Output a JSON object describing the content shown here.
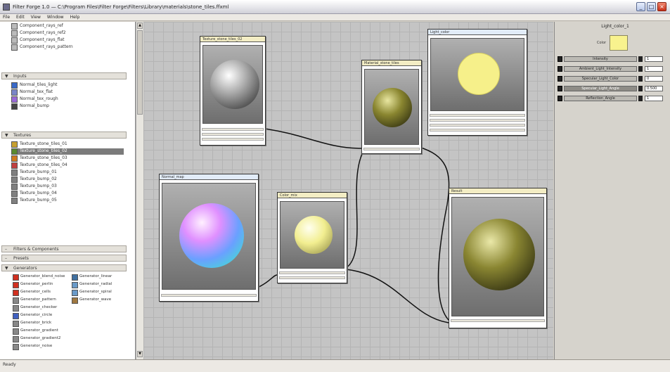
{
  "window": {
    "title": "Filter Forge 1.0 — C:\\Program Files\\Filter Forge\\Filters\\Library\\materials\\stone_tiles.ffxml",
    "minimize": "_",
    "restore": "□",
    "close": "×"
  },
  "menu": [
    "File",
    "Edit",
    "View",
    "Window",
    "Help"
  ],
  "left_panel": {
    "top_items": [
      {
        "label": "Component_rays_ref",
        "icon": "gray"
      },
      {
        "label": "Component_rays_ref2",
        "icon": "gray"
      },
      {
        "label": "Component_rays_flat",
        "icon": "gray"
      },
      {
        "label": "Component_rays_pattern",
        "icon": "gray"
      }
    ],
    "sections": {
      "inputs": "Inputs",
      "textures": "Textures",
      "filters_header": "Filters & Components",
      "presets": "Presets",
      "generators": "Generators"
    },
    "inputs_items": [
      {
        "label": "Normal_tiles_light",
        "color": "#3a6ac8"
      },
      {
        "label": "Normal_tex_flat",
        "color": "#7a86c8"
      },
      {
        "label": "Normal_tex_rough",
        "color": "#9a6ad8"
      },
      {
        "label": "Normal_bump",
        "color": "#444444"
      }
    ],
    "textures_items": [
      {
        "label": "Texture_stone_tiles_01",
        "color": "#c8a030",
        "selected": false
      },
      {
        "label": "Texture_stone_tiles_02",
        "color": "#5a8a30",
        "selected": true
      },
      {
        "label": "Texture_stone_tiles_03",
        "color": "#d07a20",
        "selected": false
      },
      {
        "label": "Texture_stone_tiles_04",
        "color": "#c04040",
        "selected": false
      },
      {
        "label": "Texture_bump_01",
        "color": "#808080",
        "selected": false
      },
      {
        "label": "Texture_bump_02",
        "color": "#808080",
        "selected": false
      },
      {
        "label": "Texture_bump_03",
        "color": "#808080",
        "selected": false
      },
      {
        "label": "Texture_bump_04",
        "color": "#808080",
        "selected": false
      },
      {
        "label": "Texture_bump_05",
        "color": "#808080",
        "selected": false
      }
    ],
    "generators_left": [
      {
        "label": "Generator_blend_noise",
        "color": "#d03020"
      },
      {
        "label": "Generator_perlin",
        "color": "#d03020"
      },
      {
        "label": "Generator_cells",
        "color": "#d03020"
      },
      {
        "label": "Generator_pattern",
        "color": "#888888"
      },
      {
        "label": "Generator_checker",
        "color": "#888888"
      },
      {
        "label": "Generator_circle",
        "color": "#4060c0"
      },
      {
        "label": "Generator_brick",
        "color": "#888888"
      },
      {
        "label": "Generator_gradient",
        "color": "#888888"
      },
      {
        "label": "Generator_gradient2",
        "color": "#888888"
      },
      {
        "label": "Generator_noise",
        "color": "#888888"
      }
    ],
    "generators_right": [
      {
        "label": "Generator_linear",
        "color": "#4070a0"
      },
      {
        "label": "Generator_radial",
        "color": "#6a9ac8"
      },
      {
        "label": "Generator_spiral",
        "color": "#6a9ac8"
      },
      {
        "label": "Generator_wave",
        "color": "#a07840"
      }
    ]
  },
  "nodes": {
    "n1": {
      "title": "Texture_stone_tiles_02"
    },
    "n2": {
      "title": "Normal_map"
    },
    "n3": {
      "title": "Color_mix"
    },
    "n4": {
      "title": "Material_stone_tiles"
    },
    "n5": {
      "title": "Light_color"
    },
    "n6": {
      "title": "Result"
    }
  },
  "right_panel": {
    "title": "Light_color_1",
    "swatch_label": "Color",
    "swatch_color": "#f8f28e",
    "params": [
      {
        "label": "Intensity",
        "value": "1"
      },
      {
        "label": "Ambient_Light_Intensity",
        "value": "1"
      },
      {
        "label": "Specular_Light_Color",
        "value": "0"
      },
      {
        "label": "Specular_Light_Angle",
        "value": "0.500"
      },
      {
        "label": "Reflection_Angle",
        "value": "1"
      }
    ]
  },
  "status": {
    "text": "Ready"
  }
}
